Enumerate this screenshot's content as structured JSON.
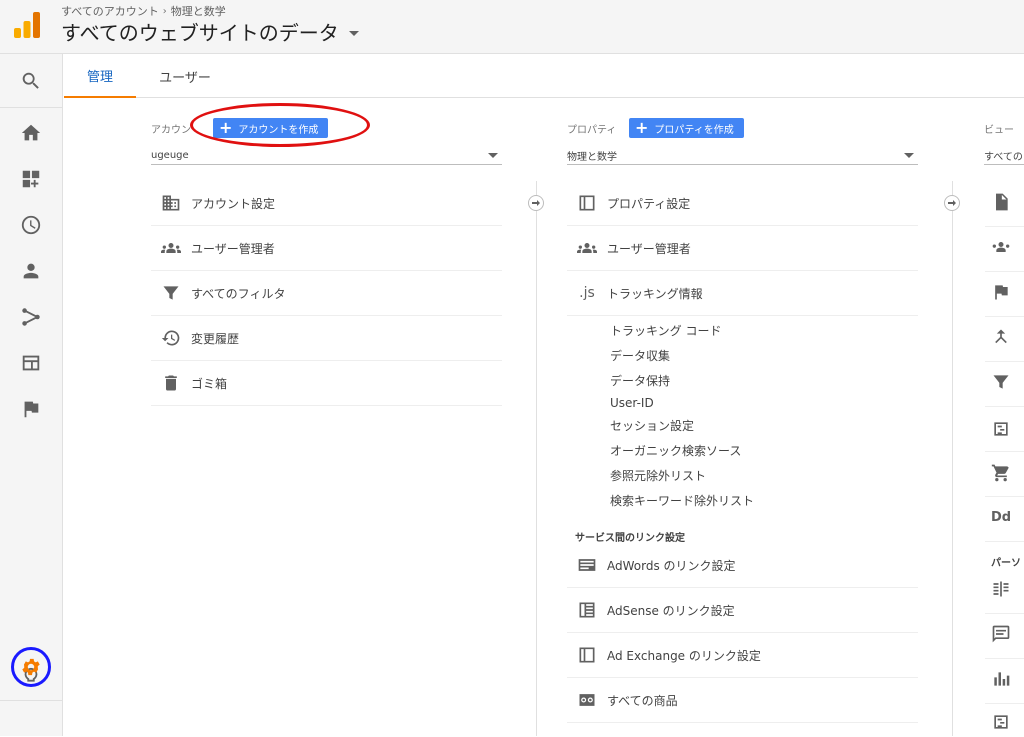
{
  "header": {
    "breadcrumb": [
      "すべてのアカウント",
      "物理と数学"
    ],
    "breadcrumb_sep": "›",
    "title": "すべてのウェブサイトのデータ"
  },
  "tabs": [
    {
      "label": "管理",
      "active": true
    },
    {
      "label": "ユーザー",
      "active": false
    }
  ],
  "account": {
    "label": "アカウン",
    "create_button": "アカウントを作成",
    "selected": "ugeuge",
    "rows": [
      "アカウント設定",
      "ユーザー管理者",
      "すべてのフィルタ",
      "変更履歴",
      "ゴミ箱"
    ]
  },
  "property": {
    "label": "プロパティ",
    "create_button": "プロパティを作成",
    "selected": "物理と数学",
    "rows": [
      "プロパティ設定",
      "ユーザー管理者",
      "トラッキング情報"
    ],
    "tracking_icon_text": ".js",
    "tracking_sub": [
      "トラッキング コード",
      "データ収集",
      "データ保持",
      "User-ID",
      "セッション設定",
      "オーガニック検索ソース",
      "参照元除外リスト",
      "検索キーワード除外リスト"
    ],
    "link_section_title": "サービス間のリンク設定",
    "link_rows": [
      "AdWords のリンク設定",
      "AdSense のリンク設定",
      "Ad Exchange のリンク設定",
      "すべての商品"
    ]
  },
  "view": {
    "label": "ビュー",
    "selected": "すべての",
    "dd_text": "Dd",
    "personal_label": "パーソ"
  },
  "colors": {
    "accent": "#f57c00",
    "primary_button": "#4285f4",
    "annotation_red": "#e01010",
    "annotation_blue": "#1a1aff"
  }
}
